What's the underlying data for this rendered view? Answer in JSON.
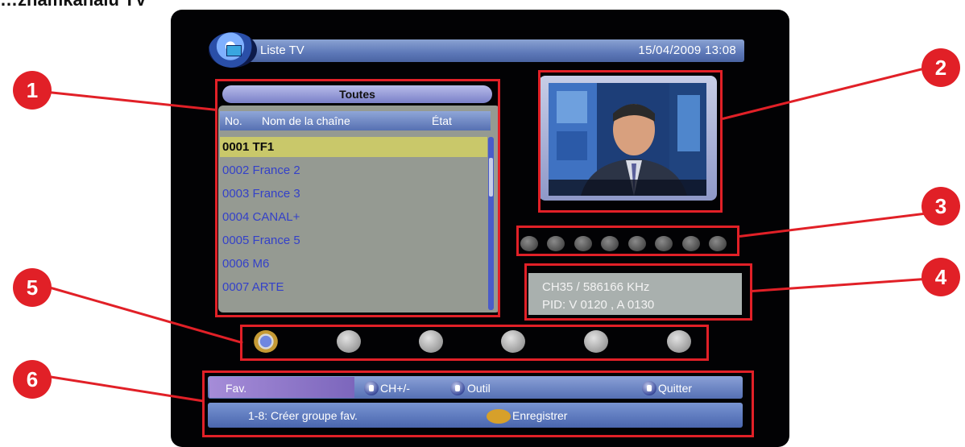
{
  "heading": "…zhamkanalu TV",
  "screen": {
    "title": "Liste TV",
    "datetime": "15/04/2009 13:08",
    "group": "Toutes",
    "columns": {
      "no": "No.",
      "name": "Nom de la chaîne",
      "state": "État"
    },
    "channels": [
      {
        "no": "0001",
        "name": "TF1"
      },
      {
        "no": "0002",
        "name": "France 2"
      },
      {
        "no": "0003",
        "name": "France 3"
      },
      {
        "no": "0004",
        "name": "CANAL+"
      },
      {
        "no": "0005",
        "name": "France 5"
      },
      {
        "no": "0006",
        "name": "M6"
      },
      {
        "no": "0007",
        "name": "ARTE"
      }
    ],
    "selected_channel_index": 0,
    "info": {
      "line1": "CH35 / 586166 KHz",
      "line2": "PID: V 0120 , A 0130"
    },
    "footer": {
      "fav": "Fav.",
      "ch": "CH+/-",
      "outil": "Outil",
      "quitter": "Quitter",
      "create_group": "1-8: Créer groupe fav.",
      "save": "Enregistrer"
    }
  },
  "callouts": [
    "1",
    "2",
    "3",
    "4",
    "5",
    "6"
  ],
  "colors": {
    "callout": "#e12027",
    "selected_row": "#c9c86a",
    "channel_text": "#3441c8"
  }
}
